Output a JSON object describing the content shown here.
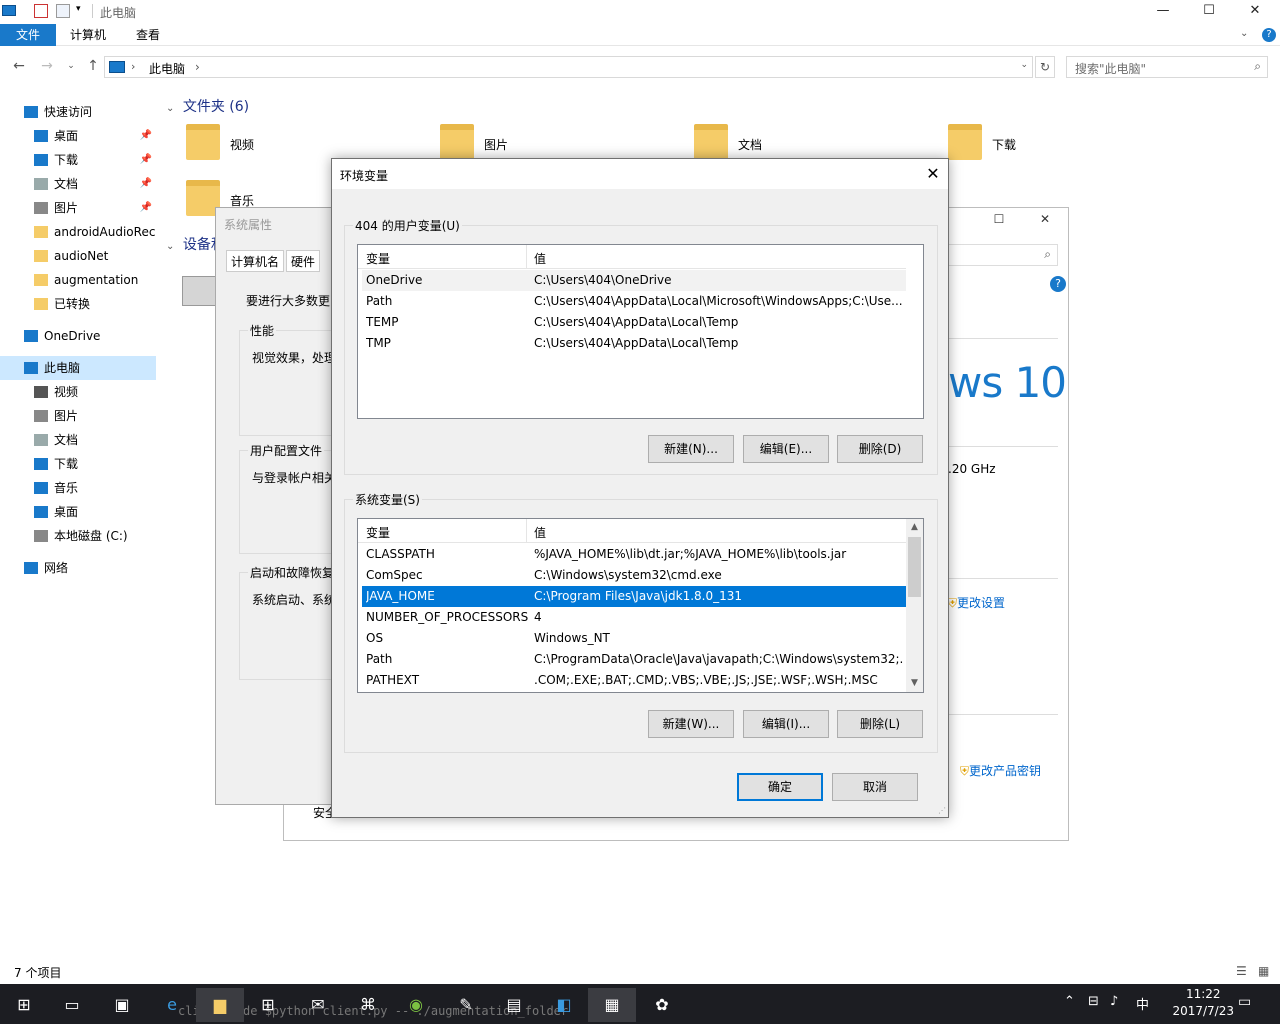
{
  "explorer": {
    "title": "此电脑",
    "window_buttons": [
      "—",
      "☐",
      "✕"
    ],
    "ribbon_tabs": [
      "文件",
      "计算机",
      "查看"
    ],
    "address": {
      "crumb": "此电脑",
      "sep": "›"
    },
    "search_placeholder": "搜索\"此电脑\"",
    "nav": [
      {
        "label": "快速访问"
      },
      {
        "label": "桌面",
        "pin": true
      },
      {
        "label": "下载",
        "pin": true
      },
      {
        "label": "文档",
        "pin": true
      },
      {
        "label": "图片",
        "pin": true
      },
      {
        "label": "androidAudioRec"
      },
      {
        "label": "audioNet"
      },
      {
        "label": "augmentation"
      },
      {
        "label": "已转换"
      },
      {
        "label": "OneDrive"
      },
      {
        "label": "此电脑"
      },
      {
        "label": "视频"
      },
      {
        "label": "图片"
      },
      {
        "label": "文档"
      },
      {
        "label": "下载"
      },
      {
        "label": "音乐"
      },
      {
        "label": "桌面"
      },
      {
        "label": "本地磁盘 (C:)"
      },
      {
        "label": "网络"
      }
    ],
    "folders_header": "文件夹 (6)",
    "folders": [
      "视频",
      "图片",
      "文档",
      "下载",
      "音乐"
    ],
    "devices_header": "设备和",
    "status": "7 个项目"
  },
  "sysprop": {
    "title": "系统属性",
    "tabs": [
      "计算机名",
      "硬件"
    ],
    "intro": "要进行大多数更",
    "perf_title": "性能",
    "perf_text": "视觉效果，处理",
    "profile_title": "用户配置文件",
    "profile_text": "与登录帐户相关",
    "startup_title": "启动和故障恢复",
    "startup_text": "系统启动、系统",
    "security": "安全"
  },
  "about": {
    "win_brand": "ws 10",
    "cpu": ".20 GHz",
    "change_settings": "更改设置",
    "change_key": "更改产品密钥",
    "buttons": [
      "☐",
      "✕"
    ]
  },
  "env": {
    "title": "环境变量",
    "user_group": "404 的用户变量(U)",
    "col_var": "变量",
    "col_val": "值",
    "user_vars": [
      {
        "name": "OneDrive",
        "value": "C:\\Users\\404\\OneDrive"
      },
      {
        "name": "Path",
        "value": "C:\\Users\\404\\AppData\\Local\\Microsoft\\WindowsApps;C:\\Use..."
      },
      {
        "name": "TEMP",
        "value": "C:\\Users\\404\\AppData\\Local\\Temp"
      },
      {
        "name": "TMP",
        "value": "C:\\Users\\404\\AppData\\Local\\Temp"
      }
    ],
    "user_buttons": [
      "新建(N)...",
      "编辑(E)...",
      "删除(D)"
    ],
    "sys_group": "系统变量(S)",
    "sys_vars": [
      {
        "name": "CLASSPATH",
        "value": "%JAVA_HOME%\\lib\\dt.jar;%JAVA_HOME%\\lib\\tools.jar"
      },
      {
        "name": "ComSpec",
        "value": "C:\\Windows\\system32\\cmd.exe"
      },
      {
        "name": "JAVA_HOME",
        "value": "C:\\Program Files\\Java\\jdk1.8.0_131"
      },
      {
        "name": "NUMBER_OF_PROCESSORS",
        "value": "4"
      },
      {
        "name": "OS",
        "value": "Windows_NT"
      },
      {
        "name": "Path",
        "value": "C:\\ProgramData\\Oracle\\Java\\javapath;C:\\Windows\\system32;..."
      },
      {
        "name": "PATHEXT",
        "value": ".COM;.EXE;.BAT;.CMD;.VBS;.VBE;.JS;.JSE;.WSF;.WSH;.MSC"
      }
    ],
    "sys_buttons": [
      "新建(W)...",
      "编辑(I)...",
      "删除(L)"
    ],
    "ok": "确定",
    "cancel": "取消"
  },
  "taskbar": {
    "time": "11:22",
    "date": "2017/7/23",
    "ime": "中",
    "bg_text": "client side  $python client.py  -- ./augmentation_folder"
  }
}
